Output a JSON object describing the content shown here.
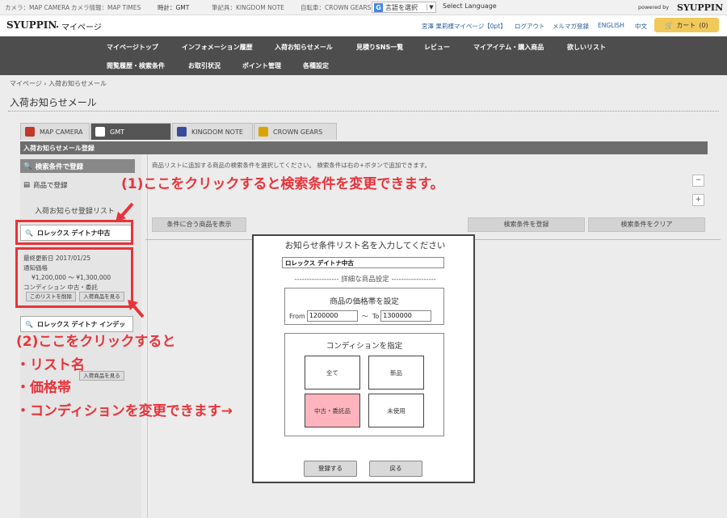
{
  "topstrip": {
    "links": [
      "カメラ：MAP CAMERA",
      "カメラ情報：MAP TIMES",
      "時計：GMT",
      "筆記具：KINGDOM NOTE",
      "自転車：CROWN GEARS"
    ],
    "lang_label": "言語を選択",
    "select_language": "Select Language",
    "powered_by": "powered by",
    "powered_logo": "SYUPPIN"
  },
  "header": {
    "logo": "SYUPPIN",
    "subtitle": "・マイページ",
    "account_links": [
      "宮澤 果莉様マイページ【0pt】",
      "ログアウト",
      "メルマガ登録",
      "ENGLISH",
      "中文"
    ],
    "cart_label": "カート",
    "cart_count": "(0)"
  },
  "nav": {
    "row1": [
      "マイページトップ",
      "インフォメーション履歴",
      "入荷お知らせメール",
      "見積りSNS一覧",
      "レビュー",
      "マイアイテム・購入商品",
      "欲しいリスト"
    ],
    "row2": [
      "閲覧履歴・検索条件",
      "お取引状況",
      "ポイント管理",
      "各種設定"
    ]
  },
  "breadcrumb": {
    "home": "マイページ",
    "sep": "›",
    "current": "入荷お知らせメール"
  },
  "page_title": "入荷お知らせメール",
  "store_tabs": [
    {
      "label": "MAP CAMERA",
      "color": "#c0392b"
    },
    {
      "label": "GMT",
      "color": "#ffffff"
    },
    {
      "label": "KINGDOM NOTE",
      "color": "#3a4a9a"
    },
    {
      "label": "CROWN GEARS",
      "color": "#d9a300"
    }
  ],
  "reg_bar": "入荷お知らせメール登録",
  "sidebar": {
    "search_label": "検索条件で登録",
    "product_label": "商品で登録",
    "list_title": "入荷お知らせ登録リスト",
    "list_items": [
      "ロレックス デイトナ中古",
      "ロレックス デイトナ インデッ"
    ],
    "detail": {
      "updated": "最終更新日 2017/01/25",
      "price_label": "通知価格",
      "price_range": "¥1,200,000 〜 ¥1,300,000",
      "condition": "コンディション 中古・委託"
    },
    "delete_btn": "このリストを削除",
    "view_btn": "入荷商品を見る",
    "view_btn2": "入荷商品を見る"
  },
  "main": {
    "instruction": "商品リストに追加する商品の検索条件を選択してください。 検索条件は右の+ボタンで追加できます。",
    "btn_matching": "条件に合う商品を表示",
    "btn_register": "検索条件を登録",
    "btn_clear": "検索条件をクリア",
    "minus": "−",
    "plus": "+"
  },
  "modal": {
    "title": "お知らせ条件リスト名を入力してください",
    "list_name": "ロレックス デイトナ中古",
    "detail_heading": "------------------ 詳細な商品設定 ------------------",
    "price_title": "商品の価格帯を設定",
    "from_label": "From",
    "from_value": "1200000",
    "tilde": "〜",
    "to_label": "To",
    "to_value": "1300000",
    "cond_title": "コンディションを指定",
    "conditions": [
      "全て",
      "新品",
      "中古・委託品",
      "未使用"
    ],
    "selected_condition": "中古・委託品",
    "register_btn": "登録する",
    "back_btn": "戻る"
  },
  "annotations": {
    "a1": "(1)ここをクリックすると検索条件を変更できます。",
    "a2": "(2)ここをクリックすると",
    "bullet1": "・リスト名",
    "bullet2": "・価格帯",
    "bullet3": "・コンディションを変更できます→",
    "color": "#e8333a"
  }
}
